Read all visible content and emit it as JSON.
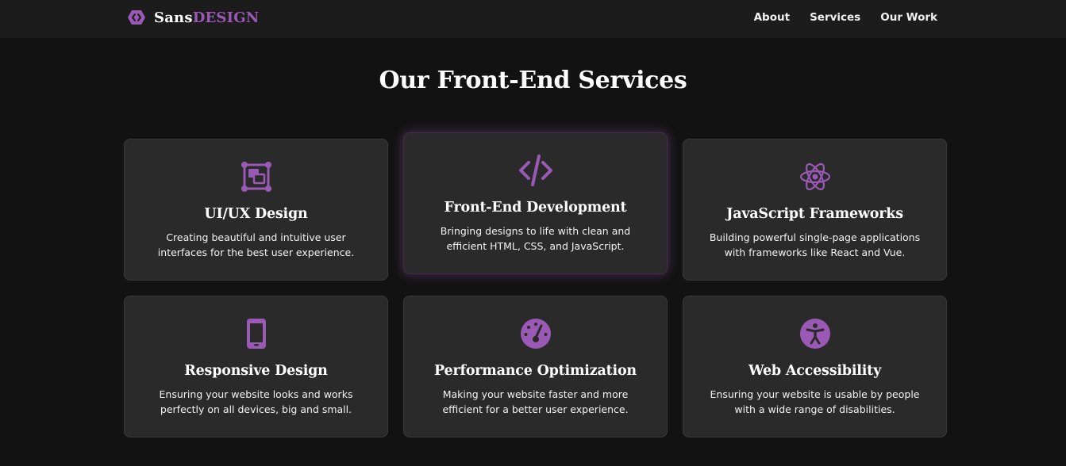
{
  "brand": {
    "icon": "code-hexagon-icon",
    "name_part1": "Sans",
    "name_part2": "DESIGN",
    "accent_color": "#9b59b6"
  },
  "nav": {
    "links": [
      {
        "label": "About"
      },
      {
        "label": "Services"
      },
      {
        "label": "Our Work"
      }
    ]
  },
  "main": {
    "title": "Our Front-End Services",
    "services": [
      {
        "icon": "vector-square-icon",
        "title": "UI/UX Design",
        "description": "Creating beautiful and intuitive user interfaces for the best user experience."
      },
      {
        "icon": "code-icon",
        "title": "Front-End Development",
        "description": "Bringing designs to life with clean and efficient HTML, CSS, and JavaScript."
      },
      {
        "icon": "react-atom-icon",
        "title": "JavaScript Frameworks",
        "description": "Building powerful single-page applications with frameworks like React and Vue."
      },
      {
        "icon": "mobile-phone-icon",
        "title": "Responsive Design",
        "description": "Ensuring your website looks and works perfectly on all devices, big and small."
      },
      {
        "icon": "gauge-icon",
        "title": "Performance Optimization",
        "description": "Making your website faster and more efficient for a better user experience."
      },
      {
        "icon": "accessibility-icon",
        "title": "Web Accessibility",
        "description": "Ensuring your website is usable by people with a wide range of disabilities."
      }
    ]
  },
  "colors": {
    "background": "#121212",
    "navbar": "#1c1c1c",
    "card": "#2a2a2a",
    "accent": "#9b59b6"
  }
}
